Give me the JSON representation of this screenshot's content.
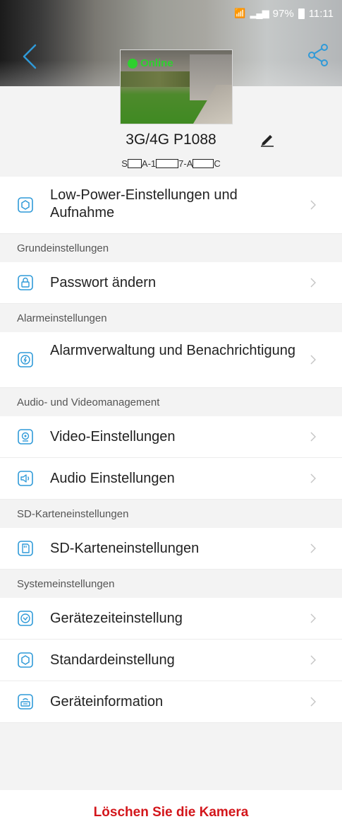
{
  "status_bar": {
    "battery": "97%",
    "time": "11:11"
  },
  "header": {
    "camera_status": "Online",
    "device_name": "3G/4G P1088",
    "serial_parts": [
      "S",
      "A-1",
      "7-A",
      "C"
    ]
  },
  "menu": {
    "low_power": "Low-Power-Einstellungen und Aufnahme",
    "section_basic": "Grundeinstellungen",
    "change_password": "Passwort ändern",
    "section_alarm": "Alarmeinstellungen",
    "alarm_management": "Alarmverwaltung und Benachrichtigung",
    "section_av": "Audio- und Videomanagement",
    "video_settings": "Video-Einstellungen",
    "audio_settings": "Audio Einstellungen",
    "section_sd": "SD-Karteneinstellungen",
    "sd_settings": "SD-Karteneinstellungen",
    "section_system": "Systemeinstellungen",
    "device_time": "Gerätezeiteinstellung",
    "default_settings": "Standardeinstellung",
    "device_info": "Geräteinformation"
  },
  "footer": {
    "delete_label": "Löschen Sie die Kamera"
  },
  "colors": {
    "accent": "#2f9ad8",
    "danger": "#d3161b",
    "online": "#2ed12e"
  }
}
